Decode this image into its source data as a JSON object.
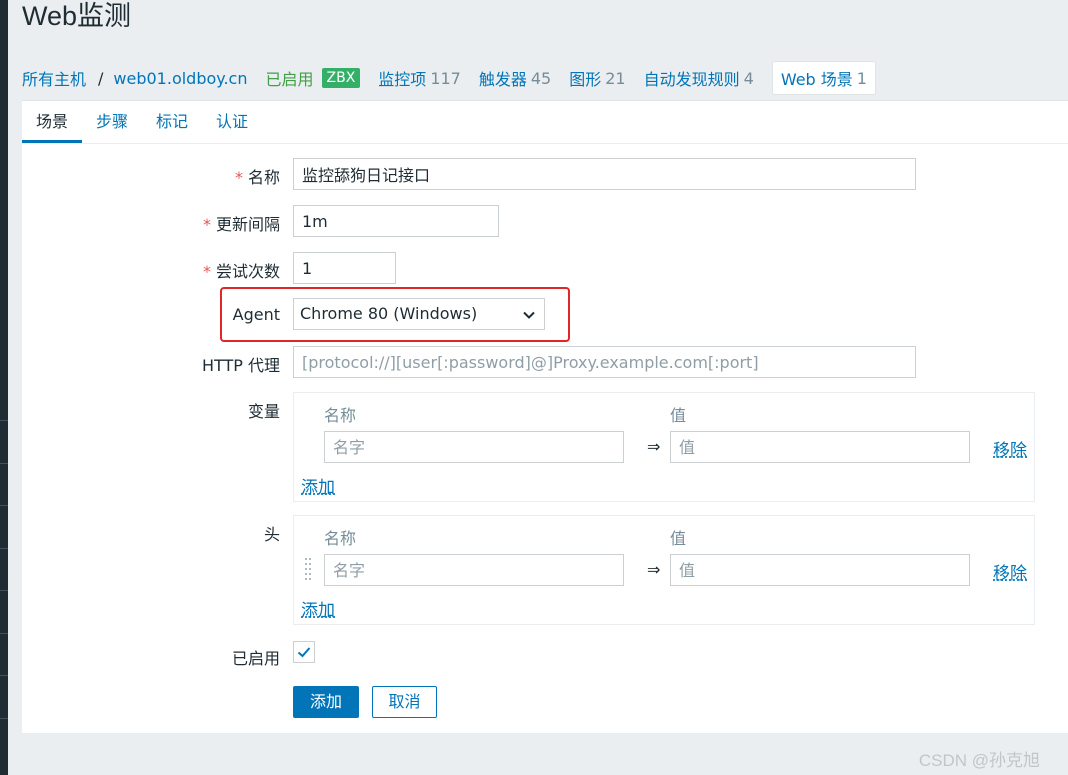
{
  "page": {
    "title": "Web监测"
  },
  "host_nav": {
    "all_hosts": "所有主机",
    "separator": "/",
    "host": "web01.oldboy.cn",
    "status": "已启用",
    "badge": "ZBX",
    "items_label": "监控项",
    "items_count": "117",
    "triggers_label": "触发器",
    "triggers_count": "45",
    "graphs_label": "图形",
    "graphs_count": "21",
    "discovery_label": "自动发现规则",
    "discovery_count": "4",
    "web_label": "Web 场景",
    "web_count": "1"
  },
  "tabs": [
    {
      "label": "场景",
      "active": true
    },
    {
      "label": "步骤"
    },
    {
      "label": "标记"
    },
    {
      "label": "认证"
    }
  ],
  "form": {
    "required_mark": "*",
    "name_label": "名称",
    "name_value": "监控舔狗日记接口",
    "interval_label": "更新间隔",
    "interval_value": "1m",
    "attempts_label": "尝试次数",
    "attempts_value": "1",
    "agent_label": "Agent",
    "agent_value": "Chrome 80 (Windows)",
    "proxy_label": "HTTP 代理",
    "proxy_placeholder": "[protocol://][user[:password]@]Proxy.example.com[:port]",
    "variables_label": "变量",
    "headers_label": "头",
    "col_name": "名称",
    "col_value": "值",
    "name_placeholder": "名字",
    "value_placeholder": "值",
    "arrow": "⇒",
    "remove": "移除",
    "add_row": "添加",
    "enabled_label": "已启用",
    "enabled": true
  },
  "buttons": {
    "add": "添加",
    "cancel": "取消"
  },
  "watermark": "CSDN @孙克旭",
  "colors": {
    "accent": "#0275b8",
    "status_green": "#429e47",
    "badge_green": "#34af67",
    "required_red": "#e45959",
    "highlight_red": "#e02727"
  }
}
